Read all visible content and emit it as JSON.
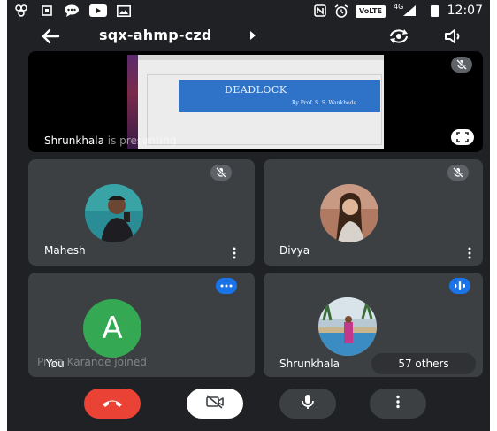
{
  "status_bar": {
    "network": "4G",
    "volte": "VoLTE",
    "time": "12:07",
    "icons": [
      "settings-gear-icon",
      "square-icon",
      "chat-icon",
      "youtube-icon",
      "gallery-icon",
      "nfc-icon",
      "alarm-icon",
      "signal-icon",
      "battery-icon"
    ]
  },
  "header": {
    "meeting_code": "sqx-ahmp-czd",
    "icons": [
      "back-arrow-icon",
      "caret-right-icon",
      "switch-camera-icon",
      "speaker-icon"
    ]
  },
  "presentation": {
    "presenter_name": "Shrunkhala",
    "presenting_suffix": " is presenting",
    "slide_title": "DEADLOCK",
    "slide_subtitle": "By Prof. S. S. Wankhede"
  },
  "participants": [
    {
      "name": "Mahesh",
      "mic": "muted"
    },
    {
      "name": "Divya",
      "mic": "muted"
    },
    {
      "name": "You",
      "avatar_letter": "A",
      "mic": "speaking"
    },
    {
      "name": "Shrunkhala",
      "mic": "speaking"
    }
  ],
  "toast": "Priya Karande joined",
  "others_count": "57 others",
  "controls": [
    "end-call-icon",
    "camera-off-icon",
    "mic-icon",
    "more-vertical-icon"
  ],
  "colors": {
    "background": "#202124",
    "tile": "#3c4043",
    "end_call": "#ea4335",
    "accent": "#1a73e8",
    "you_avatar": "#34a853"
  }
}
